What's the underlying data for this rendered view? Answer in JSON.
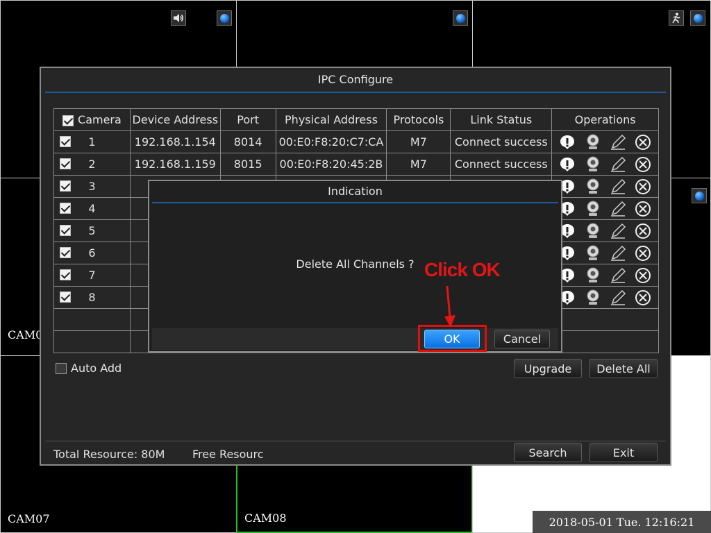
{
  "cameras": [
    {
      "label": ""
    },
    {
      "label": ""
    },
    {
      "label": ""
    },
    {
      "label": "CAM0"
    },
    {
      "label": ""
    },
    {
      "label": "CAM0"
    },
    {
      "label": "CAM07"
    },
    {
      "label": "CAM08"
    }
  ],
  "datetime": "2018-05-01 Tue. 12:16:21",
  "window": {
    "title": "IPC Configure",
    "columns": [
      "Camera",
      "Device Address",
      "Port",
      "Physical Address",
      "Protocols",
      "Link Status",
      "Operations"
    ],
    "rows": [
      {
        "camera": "1",
        "address": "192.168.1.154",
        "port": "8014",
        "mac": "00:E0:F8:20:C7:CA",
        "protocol": "M7",
        "status": "Connect success"
      },
      {
        "camera": "2",
        "address": "192.168.1.159",
        "port": "8015",
        "mac": "00:E0:F8:20:45:2B",
        "protocol": "M7",
        "status": "Connect success"
      },
      {
        "camera": "3",
        "address": "1",
        "port": "",
        "mac": "",
        "protocol": "",
        "status": ""
      },
      {
        "camera": "4",
        "address": "1",
        "port": "",
        "mac": "",
        "protocol": "",
        "status": ""
      },
      {
        "camera": "5",
        "address": "19",
        "port": "",
        "mac": "",
        "protocol": "",
        "status": ""
      },
      {
        "camera": "6",
        "address": "1",
        "port": "",
        "mac": "",
        "protocol": "",
        "status": ""
      },
      {
        "camera": "7",
        "address": "19",
        "port": "",
        "mac": "",
        "protocol": "",
        "status": ""
      },
      {
        "camera": "8",
        "address": "19",
        "port": "",
        "mac": "",
        "protocol": "",
        "status": ""
      }
    ],
    "auto_add_label": "Auto Add",
    "upgrade_label": "Upgrade",
    "delete_all_label": "Delete All",
    "total_resource": "Total Resource: 80M",
    "free_resource": "Free Resourc",
    "search_label": "Search",
    "exit_label": "Exit"
  },
  "dialog": {
    "title": "Indication",
    "message": "Delete All Channels ?",
    "ok_label": "OK",
    "cancel_label": "Cancel"
  },
  "annotation": {
    "text": "Click OK",
    "color": "#e21616"
  },
  "icons": {
    "cam1": [
      "speaker-icon",
      "record-icon"
    ],
    "cam2": [
      "record-icon"
    ],
    "cam3": [
      "motion-icon",
      "record-icon"
    ],
    "cam6": [
      "record-icon"
    ],
    "operations": [
      "info-icon",
      "camera-icon",
      "edit-icon",
      "delete-icon"
    ]
  },
  "colors": {
    "accent_blue": "#1f5a98",
    "selected_cell": "#25c225",
    "ok_button": "#0a70e0"
  }
}
